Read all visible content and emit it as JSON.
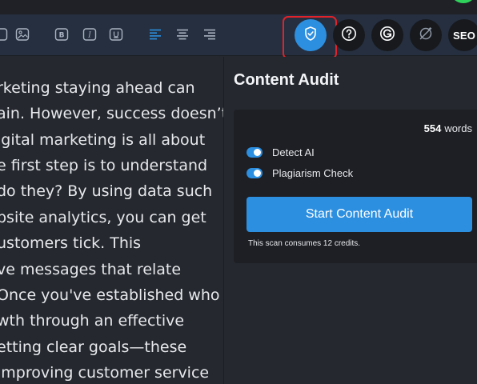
{
  "toolbar": {
    "icons": [
      "image-icon",
      "image-icon",
      "bold-icon",
      "italic-icon",
      "underline-icon",
      "align-left-icon",
      "align-center-icon",
      "align-right-icon"
    ],
    "round_buttons": [
      "shield-check-icon",
      "help-icon",
      "grammarly-icon",
      "eye-off-icon"
    ],
    "seo_label": "SEO"
  },
  "editor": {
    "lines": [
      "rketing staying ahead can",
      "ain. However, success doesn’t",
      "igital marketing is all about",
      "e first step is to understand",
      "do they? By using data such",
      "bsite analytics, you can get",
      "ustomers tick. This",
      "ve messages that relate",
      "Once you've established who",
      "wth through an effective",
      "etting clear goals—these",
      "improving customer service"
    ]
  },
  "panel": {
    "title": "Content Audit",
    "word_count": "554",
    "word_count_suffix": "words",
    "options": [
      {
        "label": "Detect AI",
        "enabled": true
      },
      {
        "label": "Plagiarism Check",
        "enabled": true
      }
    ],
    "start_label": "Start Content Audit",
    "credits_note": "This scan consumes 12 credits."
  },
  "colors": {
    "accent": "#2d8fe0",
    "highlight": "#e0222a",
    "status_green": "#2fd35b"
  }
}
